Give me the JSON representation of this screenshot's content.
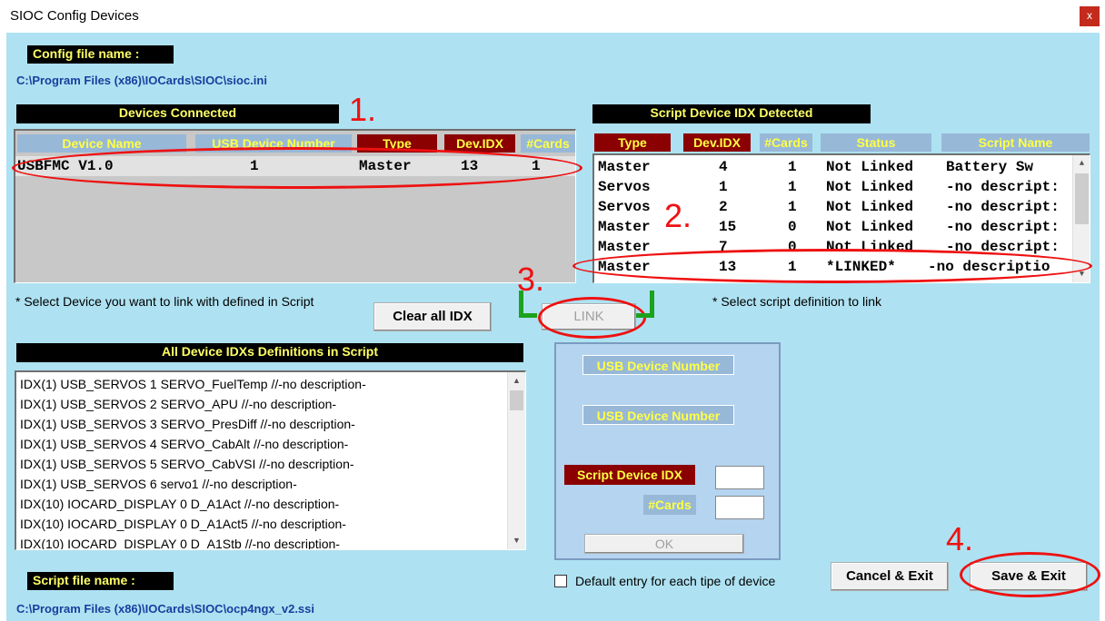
{
  "window": {
    "title": "SIOC Config Devices",
    "close_glyph": "x"
  },
  "config": {
    "label": "Config file name :",
    "path": "C:\\Program Files (x86)\\IOCards\\SIOC\\sioc.ini"
  },
  "devices_connected": {
    "title": "Devices Connected",
    "columns": [
      "Device Name",
      "USB Device Number",
      "Type",
      "Dev.IDX",
      "#Cards"
    ],
    "rows": [
      {
        "name": "USBFMC V1.0",
        "usb": "1",
        "type": "Master",
        "idx": "13",
        "cards": "1"
      }
    ],
    "hint": "* Select Device  you want to link with defined in Script"
  },
  "script_detected": {
    "title": "Script Device IDX Detected",
    "columns": [
      "Type",
      "Dev.IDX",
      "#Cards",
      "Status",
      "Script Name"
    ],
    "rows": [
      {
        "type": "Master",
        "idx": "4",
        "cards": "1",
        "status": "Not Linked",
        "name": "Battery Sw"
      },
      {
        "type": "Servos",
        "idx": "1",
        "cards": "1",
        "status": "Not Linked",
        "name": "-no descript:"
      },
      {
        "type": "Servos",
        "idx": "2",
        "cards": "1",
        "status": "Not Linked",
        "name": "-no descript:"
      },
      {
        "type": "Master",
        "idx": "15",
        "cards": "0",
        "status": "Not Linked",
        "name": "-no descript:"
      },
      {
        "type": "Master",
        "idx": "7",
        "cards": "0",
        "status": "Not Linked",
        "name": "-no descript:"
      },
      {
        "type": "Master",
        "idx": "13",
        "cards": "1",
        "status": "*LINKED*",
        "name": "-no descriptio"
      }
    ],
    "hint": "* Select script definition to link"
  },
  "buttons": {
    "clear": "Clear all IDX",
    "link": "LINK",
    "ok": "OK",
    "cancel": "Cancel & Exit",
    "save": "Save & Exit"
  },
  "definitions": {
    "title": "All Device IDXs Definitions in Script",
    "items": [
      "IDX(1)  USB_SERVOS 1 SERVO_FuelTemp //-no description-",
      "IDX(1)  USB_SERVOS 2 SERVO_APU //-no description-",
      "IDX(1)  USB_SERVOS 3 SERVO_PresDiff //-no description-",
      "IDX(1)  USB_SERVOS 4 SERVO_CabAlt //-no description-",
      "IDX(1)  USB_SERVOS 5 SERVO_CabVSI //-no description-",
      "IDX(1)  USB_SERVOS 6 servo1 //-no description-",
      "IDX(10)  IOCARD_DISPLAY 0 D_A1Act //-no description-",
      "IDX(10)  IOCARD_DISPLAY 0 D_A1Act5 //-no description-",
      "IDX(10)  IOCARD_DISPLAY 0 D_A1Stb //-no description-"
    ]
  },
  "link_panel": {
    "usb1": "USB Device Number",
    "usb2": "USB Device Number",
    "script_idx": "Script Device IDX",
    "cards": "#Cards"
  },
  "default_entry": {
    "label": "Default entry for each tipe of device",
    "checked": false
  },
  "script_file": {
    "label": "Script file name :",
    "path": "C:\\Program Files (x86)\\IOCards\\SIOC\\ocp4ngx_v2.ssi"
  },
  "annotations": {
    "n1": "1.",
    "n2": "2.",
    "n3": "3.",
    "n4": "4."
  }
}
